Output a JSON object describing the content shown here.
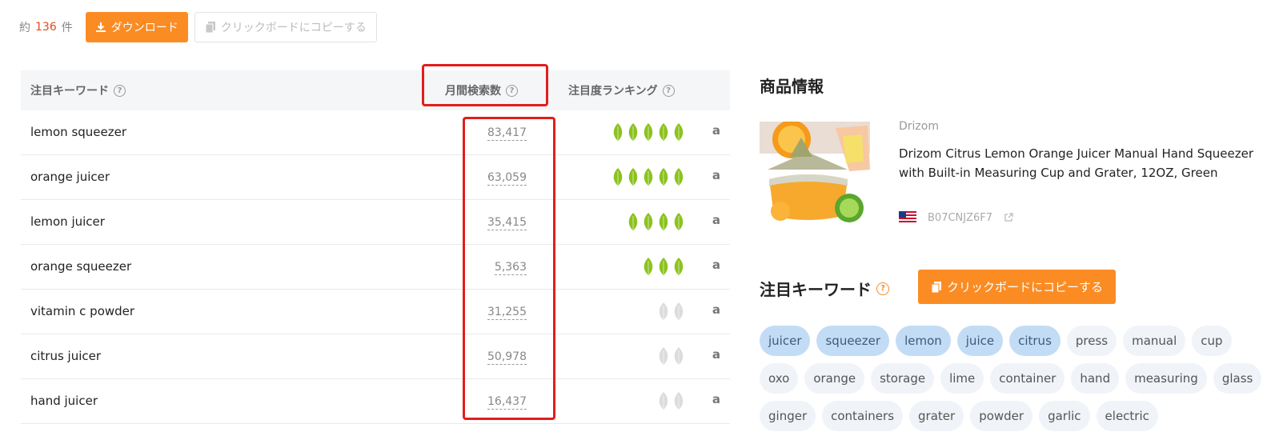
{
  "toolbar": {
    "count_prefix": "約",
    "count_value": "136",
    "count_suffix": "件",
    "download_label": "ダウンロード",
    "copy_label": "クリックボードにコピーする"
  },
  "table": {
    "headers": {
      "keyword": "注目キーワード",
      "volume": "月間検索数",
      "ranking": "注目度ランキング"
    },
    "rows": [
      {
        "keyword": "lemon squeezer",
        "volume": "83,417",
        "leaves": 5,
        "leaf_color": "green"
      },
      {
        "keyword": "orange juicer",
        "volume": "63,059",
        "leaves": 5,
        "leaf_color": "green"
      },
      {
        "keyword": "lemon juicer",
        "volume": "35,415",
        "leaves": 4,
        "leaf_color": "green"
      },
      {
        "keyword": "orange squeezer",
        "volume": "5,363",
        "leaves": 3,
        "leaf_color": "green"
      },
      {
        "keyword": "vitamin c powder",
        "volume": "31,255",
        "leaves": 2,
        "leaf_color": "gray"
      },
      {
        "keyword": "citrus juicer",
        "volume": "50,978",
        "leaves": 2,
        "leaf_color": "gray"
      },
      {
        "keyword": "hand juicer",
        "volume": "16,437",
        "leaves": 2,
        "leaf_color": "gray"
      }
    ],
    "amazon_icon_text": "a"
  },
  "product": {
    "heading": "商品情報",
    "brand": "Drizom",
    "title": "Drizom Citrus Lemon Orange Juicer Manual Hand Squeezer with Built-in Measuring Cup and Grater, 12OZ, Green",
    "asin": "B07CNJZ6F7"
  },
  "keywords": {
    "heading": "注目キーワード",
    "copy_label": "クリックボードにコピーする",
    "tags": [
      {
        "label": "juicer",
        "selected": true
      },
      {
        "label": "squeezer",
        "selected": true
      },
      {
        "label": "lemon",
        "selected": true
      },
      {
        "label": "juice",
        "selected": true
      },
      {
        "label": "citrus",
        "selected": true
      },
      {
        "label": "press",
        "selected": false
      },
      {
        "label": "manual",
        "selected": false
      },
      {
        "label": "cup",
        "selected": false
      },
      {
        "label": "oxo",
        "selected": false
      },
      {
        "label": "orange",
        "selected": false
      },
      {
        "label": "storage",
        "selected": false
      },
      {
        "label": "lime",
        "selected": false
      },
      {
        "label": "container",
        "selected": false
      },
      {
        "label": "hand",
        "selected": false
      },
      {
        "label": "measuring",
        "selected": false
      },
      {
        "label": "glass",
        "selected": false
      },
      {
        "label": "ginger",
        "selected": false
      },
      {
        "label": "containers",
        "selected": false
      },
      {
        "label": "grater",
        "selected": false
      },
      {
        "label": "powder",
        "selected": false
      },
      {
        "label": "garlic",
        "selected": false
      },
      {
        "label": "electric",
        "selected": false
      }
    ]
  },
  "colors": {
    "accent": "#fb8c23",
    "leaf_green": "#8cc21f",
    "leaf_gray": "#dcdcdc",
    "highlight": "#e31d1d",
    "tag_selected": "#c3dcf6"
  }
}
